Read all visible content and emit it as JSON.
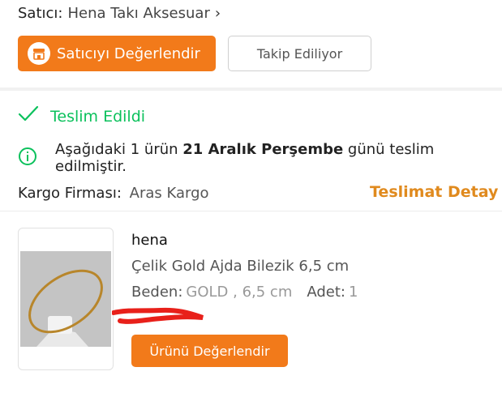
{
  "seller": {
    "label": "Satıcı:",
    "name": "Hena Takı Aksesuar",
    "chevron": "›",
    "rate_button": "Satıcıyı Değerlendir",
    "rate_icon": "store-icon",
    "follow_button": "Takip Ediliyor"
  },
  "status": {
    "icon": "check-icon",
    "text": "Teslim Edildi",
    "color": "#0bc15c"
  },
  "info": {
    "icon": "info-circle-icon",
    "pre": "Aşağıdaki 1 ürün ",
    "bold": "21 Aralık Perşembe",
    "post": " günü teslim edilmiştir."
  },
  "cargo": {
    "label": "Kargo Firması:",
    "value": "Aras Kargo",
    "detail_link": "Teslimat Detay"
  },
  "product": {
    "brand": "hena",
    "name": "Çelik Gold Ajda Bilezik 6,5 cm",
    "size_label": "Beden:",
    "size_value": "GOLD , 6,5 cm",
    "qty_label": "Adet:",
    "qty_value": "1",
    "rate_button": "Ürünü Değerlendir"
  },
  "colors": {
    "accent": "#f27a1a",
    "link": "#e08a1e"
  }
}
